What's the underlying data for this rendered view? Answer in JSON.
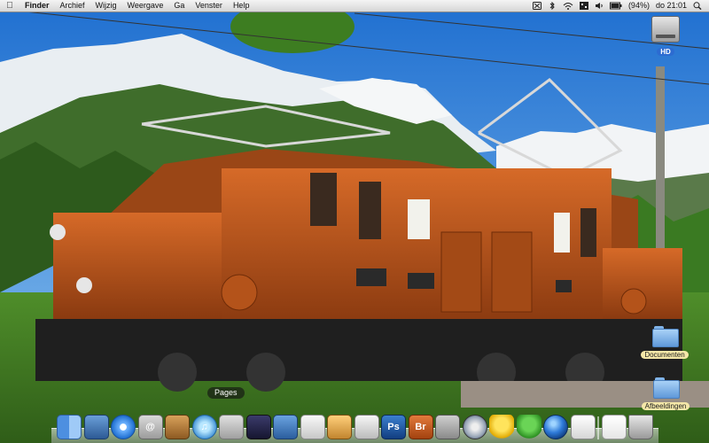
{
  "menubar": {
    "apple_icon": "apple-icon",
    "items": [
      "Finder",
      "Archief",
      "Wijzig",
      "Weergave",
      "Ga",
      "Venster",
      "Help"
    ],
    "status": {
      "battery_percent": "(94%)",
      "clock": "do 21:01"
    },
    "status_icons": [
      "time-machine-icon",
      "bluetooth-icon",
      "wifi-icon",
      "spaces-icon",
      "volume-icon",
      "battery-icon",
      "spotlight-icon"
    ]
  },
  "desktop": {
    "hd_label": "HD",
    "documenten_label": "Documenten",
    "afbeeldingen_label": "Afbeeldingen"
  },
  "dock": {
    "tooltip": "Pages",
    "apps": [
      {
        "name": "finder",
        "glyph": ""
      },
      {
        "name": "preview",
        "glyph": ""
      },
      {
        "name": "safari",
        "glyph": ""
      },
      {
        "name": "mail",
        "glyph": "@"
      },
      {
        "name": "address-book",
        "glyph": ""
      },
      {
        "name": "itunes",
        "glyph": "♫"
      },
      {
        "name": "ical",
        "glyph": ""
      },
      {
        "name": "photo-booth",
        "glyph": ""
      },
      {
        "name": "keynote",
        "glyph": ""
      },
      {
        "name": "pages",
        "glyph": ""
      },
      {
        "name": "iphoto",
        "glyph": ""
      },
      {
        "name": "image-capture",
        "glyph": ""
      },
      {
        "name": "photoshop",
        "glyph": "Ps"
      },
      {
        "name": "bridge",
        "glyph": "Br"
      },
      {
        "name": "time-machine",
        "glyph": ""
      },
      {
        "name": "dvd-player",
        "glyph": ""
      },
      {
        "name": "adium",
        "glyph": ""
      },
      {
        "name": "ichat",
        "glyph": ""
      },
      {
        "name": "google-earth",
        "glyph": ""
      },
      {
        "name": "stack",
        "glyph": ""
      },
      {
        "name": "document",
        "glyph": ""
      },
      {
        "name": "trash",
        "glyph": ""
      }
    ]
  },
  "colors": {
    "accent_blue": "#2c6bd1",
    "locomotive": "#c0581c",
    "sky": "#3e88d6"
  }
}
